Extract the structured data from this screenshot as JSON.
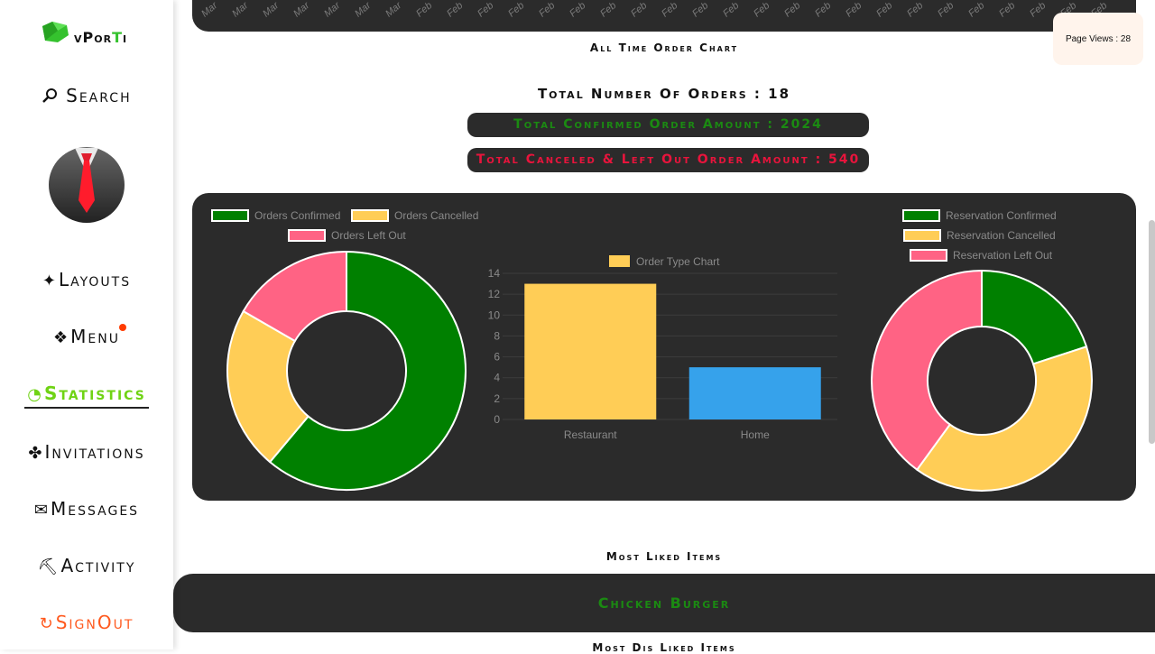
{
  "app": {
    "brand_pre": "vPor",
    "brand_mid": "T",
    "brand_post": "i"
  },
  "sidebar": {
    "search": {
      "label": "Search",
      "icon": "search-icon"
    },
    "items": [
      {
        "label": "Layouts",
        "icon": "sparkle-icon",
        "glyph": "✦"
      },
      {
        "label": "Menu",
        "icon": "menu-diamond-icon",
        "glyph": "❖"
      },
      {
        "label": "Statistics",
        "icon": "pie-icon",
        "glyph": "◔"
      },
      {
        "label": "Invitations",
        "icon": "club-icon",
        "glyph": "✤"
      },
      {
        "label": "Messages",
        "icon": "mail-icon",
        "glyph": "✉"
      },
      {
        "label": "Activity",
        "icon": "pick-icon",
        "glyph": "⛏"
      },
      {
        "label": "SignOut",
        "icon": "signout-icon",
        "glyph": "↻"
      }
    ]
  },
  "page_views": {
    "text": "Page Views : 28"
  },
  "top_chart": {
    "ticks": [
      "Mar",
      "Mar",
      "Mar",
      "Mar",
      "Mar",
      "Mar",
      "Mar",
      "Feb",
      "Feb",
      "Feb",
      "Feb",
      "Feb",
      "Feb",
      "Feb",
      "Feb",
      "Feb",
      "Feb",
      "Feb",
      "Feb",
      "Feb",
      "Feb",
      "Feb",
      "Feb",
      "Feb",
      "Feb",
      "Feb",
      "Feb",
      "Feb",
      "Feb",
      "Feb"
    ]
  },
  "headings": {
    "all_time": "All Time Order Chart",
    "total_orders": "Total Number Of Orders : 18",
    "confirmed_amount": "Total Confirmed Order Amount : 2024",
    "canceled_amount": "Total Canceled & Left Out Order Amount : 540",
    "most_liked": "Most Liked Items",
    "most_liked_item": "Chicken Burger",
    "most_disliked": "Most Dis Liked Items"
  },
  "colors": {
    "green": "#008000",
    "yellow": "#ffcd56",
    "pink": "#ff6384",
    "blue": "#36a2eb",
    "panel": "#2b2b2b",
    "confirmed_text": "#1b8a12",
    "canceled_text": "#e8143c"
  },
  "chart_data": [
    {
      "type": "pie",
      "legend": [
        "Orders Confirmed",
        "Orders Cancelled",
        "Orders Left Out"
      ],
      "values": [
        11,
        4,
        3
      ]
    },
    {
      "type": "bar",
      "series": [
        {
          "name": "Order Type Chart",
          "values": [
            13,
            5
          ]
        }
      ],
      "categories": [
        "Restaurant",
        "Home"
      ],
      "ylim": [
        0,
        14
      ],
      "yticks": [
        0,
        2,
        4,
        6,
        8,
        10,
        12,
        14
      ]
    },
    {
      "type": "pie",
      "legend": [
        "Reservation Confirmed",
        "Reservation Cancelled",
        "Reservation Left Out"
      ],
      "values": [
        2,
        4,
        4
      ]
    }
  ]
}
